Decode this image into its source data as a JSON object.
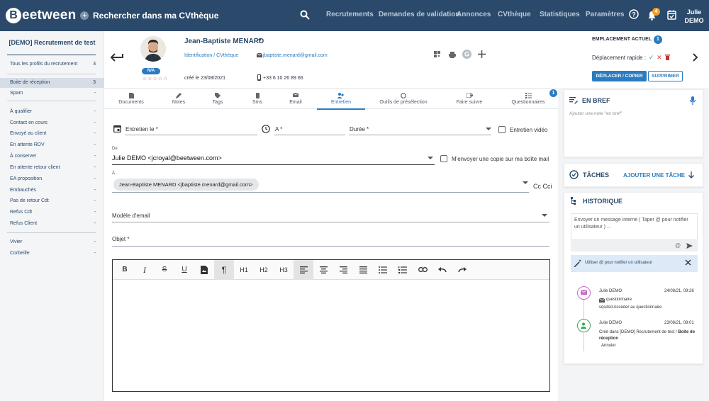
{
  "topbar": {
    "logo_letter": "B",
    "logo_text": "eetween",
    "logo_plus": "+",
    "search_label": "Rechercher dans ma CVthèque",
    "nav": [
      "Recrutements",
      "Demandes de validation",
      "Annonces",
      "CVthèque",
      "Statistiques",
      "Paramètres"
    ],
    "notif_count": "4",
    "user_first": "Julie",
    "user_last": "DEMO"
  },
  "sidebar": {
    "title": "[DEMO] Recrutement de test",
    "items": [
      {
        "label": "Tous les profils du recrutement",
        "count": "3"
      },
      {
        "label": "Boite de réception",
        "count": "3"
      },
      {
        "label": "Spam",
        "count": "-"
      },
      {
        "label": "À qualifier",
        "count": "-"
      },
      {
        "label": "Contact en cours",
        "count": "-"
      },
      {
        "label": "Envoyé au client",
        "count": "-"
      },
      {
        "label": "En attente RDV",
        "count": "-"
      },
      {
        "label": "À conserver",
        "count": "-"
      },
      {
        "label": "En attente retour client",
        "count": "-"
      },
      {
        "label": "EA proposition",
        "count": "-"
      },
      {
        "label": "Embauchés",
        "count": "-"
      },
      {
        "label": "Pas de retour Cdt",
        "count": "-"
      },
      {
        "label": "Refus Cdt",
        "count": "-"
      },
      {
        "label": "Refus Client",
        "count": "-"
      },
      {
        "label": "Vivier",
        "count": "-"
      },
      {
        "label": "Corbeille",
        "count": "-"
      }
    ]
  },
  "candidate": {
    "name": "Jean-Baptiste MENARD",
    "status": "N/A",
    "rating_stars": "☆☆☆☆☆",
    "identification": "Identification / CVthèque",
    "email": "jbaptiste.menard@gmail.com",
    "created": "créé le 23/08/2021",
    "phone": "+33 6 10 26 89 66"
  },
  "location": {
    "title": "EMPLACEMENT ACTUEL",
    "badge": "1",
    "quick_move": "Déplacement rapide :",
    "move_button": "DÉPLACER / COPIER",
    "delete_button": "SUPPRIMER"
  },
  "tabs": [
    {
      "label": "Documents",
      "icon": "document-icon"
    },
    {
      "label": "Notes",
      "icon": "pencil-icon"
    },
    {
      "label": "Tags",
      "icon": "tag-icon"
    },
    {
      "label": "Sms",
      "icon": "phone-icon"
    },
    {
      "label": "Email",
      "icon": "envelope-icon"
    },
    {
      "label": "Entretien",
      "icon": "people-icon"
    },
    {
      "label": "Outils de présélection",
      "icon": "compass-icon"
    },
    {
      "label": "Faire suivre",
      "icon": "forward-icon"
    },
    {
      "label": "Questionnaires",
      "icon": "list-icon"
    }
  ],
  "tab_badge": "1",
  "form": {
    "date_label": "Entretien le *",
    "time_label": "A *",
    "duration_label": "Durée *",
    "video_label": "Entretien vidéo",
    "from_small": "De",
    "from_value": "Julie DEMO <jcroyal@beetween.com>",
    "copy_label": "M'envoyer une copie sur ma boîte mail",
    "to_small": "À",
    "to_chip": "Jean-Baptiste MENARD <jbaptiste.menard@gmail.com>",
    "cc": "Cc Cci",
    "template_label": "Modèle d'email",
    "subject_label": "Objet *"
  },
  "editor": {
    "tools": [
      "B",
      "I",
      "S",
      "U",
      "img",
      "¶",
      "H1",
      "H2",
      "H3",
      "align-left",
      "align-center",
      "align-right",
      "justify",
      "ul",
      "ol",
      "link",
      "undo",
      "redo"
    ]
  },
  "brief": {
    "title": "EN BREF",
    "placeholder": "Ajouter une note \"en bref\""
  },
  "tasks": {
    "title": "TÂCHES",
    "add": "AJOUTER UNE TÂCHE"
  },
  "history": {
    "title": "HISTORIQUE",
    "input_placeholder": "Envoyer un message interne ( Taper @ pour notifier un utilisateur ) ...",
    "at": "@",
    "tip": "Utiliser @ pour notifier un utilisateur",
    "events": [
      {
        "user": "Julie DEMO",
        "date": "24/08/21, 09:26",
        "line1": "questionnaire",
        "line2": "sqsdsd Accéder au questionnaire"
      },
      {
        "user": "Julie DEMO",
        "date": "23/08/21, 08:01",
        "line1": "Créé dans [DEMO] Recrutement de test / ",
        "line1b": "Boîte de réception",
        "line2": "Annuler"
      }
    ]
  }
}
